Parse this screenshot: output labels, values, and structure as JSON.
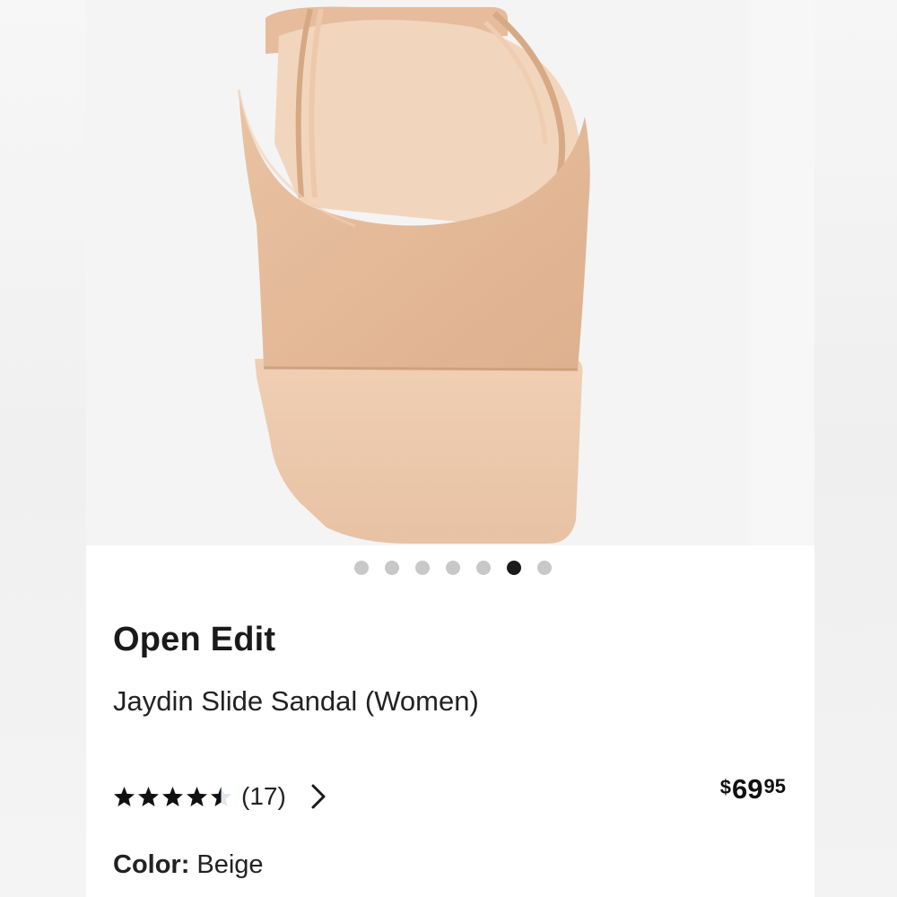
{
  "product": {
    "brand": "Open Edit",
    "name": "Jaydin Slide Sandal (Women)",
    "rating": 4.5,
    "rating_max": 5,
    "review_count": "(17)",
    "price_currency": "$",
    "price_dollars": "69",
    "price_cents": "95",
    "color_label": "Color:",
    "color_value": "Beige"
  },
  "gallery": {
    "image_count": 7,
    "active_index": 5,
    "product_color": "#e3b999"
  },
  "icons": {
    "star": "star-icon",
    "chevron": "chevron-right-icon"
  }
}
